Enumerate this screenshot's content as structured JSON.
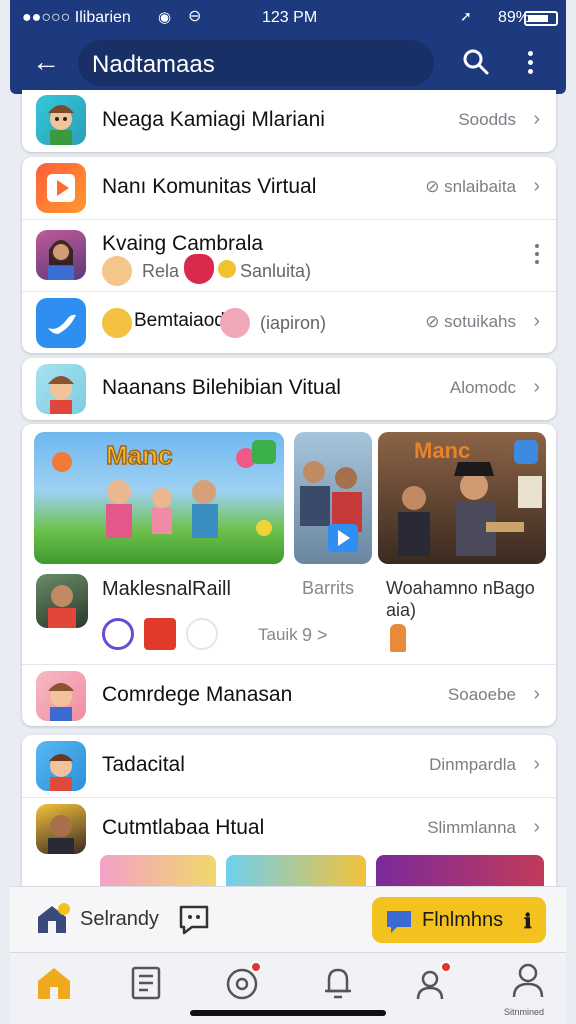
{
  "status": {
    "carrier": "●●○○○ Ilibarien",
    "time": "123 PM",
    "battery": "89%"
  },
  "appbar": {
    "search_value": "Nadtamaas"
  },
  "list": {
    "row1": {
      "title": "Neaga Kamiagi Mlariani",
      "meta": "Soodds"
    },
    "group": {
      "row_a": {
        "title": "Nanı Komunitas Virtual",
        "meta": "⊘ snlaibaita"
      },
      "row_b": {
        "title": "Kvaing Cambrala",
        "sub_left": "Rela",
        "sub_right": "Sanluita)"
      },
      "row_c": {
        "title": "Bemtaiaod",
        "sub": "(iapiron)",
        "meta": "⊘ sotuikahs"
      }
    },
    "row2": {
      "title": "Naanans Bilehibian Vitual",
      "meta": "Alomodc"
    },
    "media": {
      "left_caption": "MaklesnalRaill",
      "left_tag": "Tauik",
      "mid_caption": "Barrits",
      "mid_meta": "9 >",
      "right_caption": "Woahamno nBago",
      "right_caption2": "aia)",
      "right_poster_text": "Manc"
    },
    "row3": {
      "title": "Comrdege Manasan",
      "meta": "Soaoebe"
    },
    "row4": {
      "title": "Tadacital",
      "meta": "Dinmpardla"
    },
    "row5": {
      "title": "Cutmtlabaa Htual",
      "meta": "Slimmlanna"
    }
  },
  "actionbar": {
    "left_label": "Selrandy",
    "right_button": "Flnlmhns"
  },
  "nav": {
    "profile_label": "Sitnmined"
  },
  "colors": {
    "appbar": "#1e3a7e",
    "accent": "#f4c21e",
    "nav_active": "#f0a81c"
  }
}
